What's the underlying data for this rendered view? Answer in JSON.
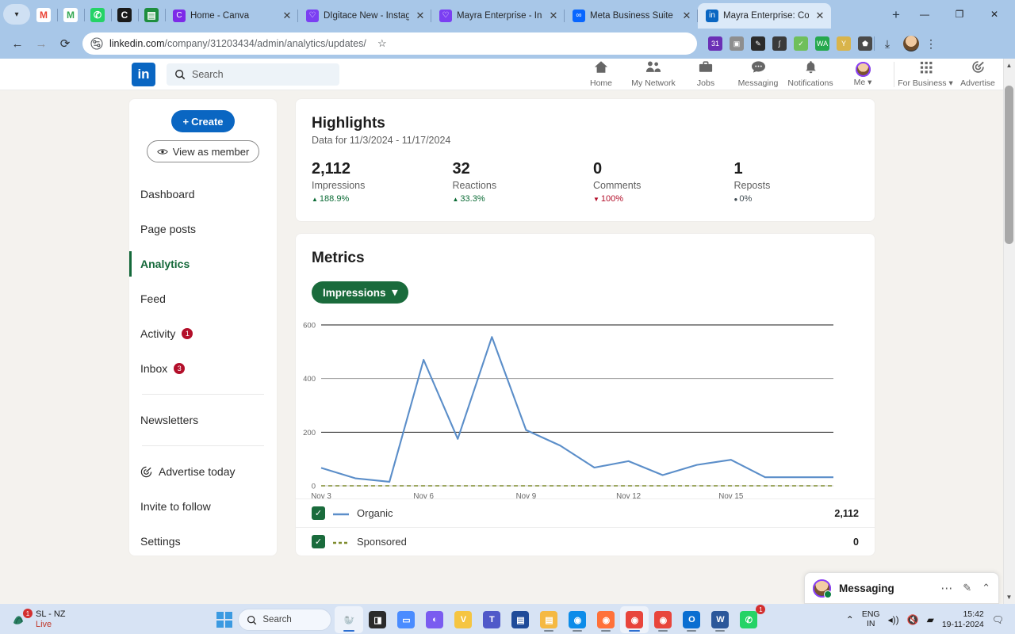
{
  "browser": {
    "pinned_tabs": [
      {
        "name": "gmail-pin",
        "glyph": "M",
        "color": "#ea4335",
        "bg": "#ffffff"
      },
      {
        "name": "gmail-alt-pin",
        "glyph": "M",
        "color": "#34a853",
        "bg": "#ffffff"
      },
      {
        "name": "whatsapp-pin",
        "glyph": "✆",
        "color": "#ffffff",
        "bg": "#25d366"
      },
      {
        "name": "canva-pin",
        "glyph": "C",
        "color": "#ffffff",
        "bg": "#1a1a1a"
      },
      {
        "name": "sheets-pin",
        "glyph": "▤",
        "color": "#ffffff",
        "bg": "#1e8e3e"
      }
    ],
    "tabs": [
      {
        "title": "Home - Canva",
        "favicon": "canva-icon",
        "fav_color": "#7d2ae8",
        "fav_glyph": "C",
        "active": false
      },
      {
        "title": "DIgitace New - Instagram",
        "favicon": "instagram-icon",
        "fav_color": "#7b3ff2",
        "fav_glyph": "♡",
        "active": false
      },
      {
        "title": "Mayra Enterprise - Instagr",
        "favicon": "instagram-icon",
        "fav_color": "#7b3ff2",
        "fav_glyph": "♡",
        "active": false
      },
      {
        "title": "Meta Business Suite",
        "favicon": "meta-icon",
        "fav_color": "#0866ff",
        "fav_glyph": "∞",
        "active": false
      },
      {
        "title": "Mayra Enterprise: Compan",
        "favicon": "linkedin-icon",
        "fav_color": "#0a66c2",
        "fav_glyph": "in",
        "active": true
      }
    ],
    "new_tab_label": "+",
    "window_controls": {
      "minimize": "—",
      "maximize": "❐",
      "close": "✕"
    },
    "nav": {
      "back": "←",
      "forward": "→",
      "reload": "⟳"
    },
    "url_domain": "linkedin.com",
    "url_path": "/company/31203434/admin/analytics/updates/",
    "star": "☆",
    "extensions": [
      {
        "name": "calendar-extension-icon",
        "glyph": "31",
        "bg": "#6b2fb5"
      },
      {
        "name": "camera-extension-icon",
        "glyph": "▣",
        "bg": "#8e8e8e"
      },
      {
        "name": "pen-extension-icon",
        "glyph": "✎",
        "bg": "#2b2b2b"
      },
      {
        "name": "formula-extension-icon",
        "glyph": "∫",
        "bg": "#3a3a3a"
      },
      {
        "name": "grammar-extension-icon",
        "glyph": "✓",
        "bg": "#6fbf5a"
      },
      {
        "name": "wa-extension-icon",
        "glyph": "WA",
        "bg": "#25a84d"
      },
      {
        "name": "y-extension-icon",
        "glyph": "Y",
        "bg": "#d9b44a"
      },
      {
        "name": "puzzle-extension-icon",
        "glyph": "⬟",
        "bg": "#4a4a4a"
      }
    ],
    "download_icon": "⤓",
    "menu_icon": "⋮"
  },
  "linkedin_nav": {
    "logo": "in",
    "search_placeholder": "Search",
    "items": [
      {
        "label": "Home",
        "icon": "home-icon"
      },
      {
        "label": "My Network",
        "icon": "network-icon"
      },
      {
        "label": "Jobs",
        "icon": "briefcase-icon"
      },
      {
        "label": "Messaging",
        "icon": "message-icon"
      },
      {
        "label": "Notifications",
        "icon": "bell-icon"
      },
      {
        "label": "Me",
        "icon": "avatar-icon"
      }
    ],
    "right_items": [
      {
        "label": "For Business",
        "icon": "grid-icon"
      },
      {
        "label": "Advertise",
        "icon": "advertise-icon"
      }
    ]
  },
  "sidebar": {
    "create_button": "Create",
    "create_plus": "+",
    "view_as_member": "View as member",
    "items": [
      {
        "label": "Dashboard",
        "active": false,
        "badge": null
      },
      {
        "label": "Page posts",
        "active": false,
        "badge": null
      },
      {
        "label": "Analytics",
        "active": true,
        "badge": null
      },
      {
        "label": "Feed",
        "active": false,
        "badge": null
      },
      {
        "label": "Activity",
        "active": false,
        "badge": "1"
      },
      {
        "label": "Inbox",
        "active": false,
        "badge": "3"
      }
    ],
    "newsletters": "Newsletters",
    "advertise_today": "Advertise today",
    "invite_to_follow": "Invite to follow",
    "settings": "Settings"
  },
  "highlights": {
    "title": "Highlights",
    "subtitle": "Data for 11/3/2024 - 11/17/2024",
    "stats": [
      {
        "value": "2,112",
        "label": "Impressions",
        "delta": "188.9%",
        "dir": "up",
        "arrow": "▲"
      },
      {
        "value": "32",
        "label": "Reactions",
        "delta": "33.3%",
        "dir": "up",
        "arrow": "▲"
      },
      {
        "value": "0",
        "label": "Comments",
        "delta": "100%",
        "dir": "down",
        "arrow": "▼"
      },
      {
        "value": "1",
        "label": "Reposts",
        "delta": "0%",
        "dir": "flat",
        "arrow": "●"
      }
    ]
  },
  "metrics": {
    "title": "Metrics",
    "selector_label": "Impressions",
    "selector_caret": "▾",
    "legend": [
      {
        "name": "Organic",
        "value": "2,112",
        "color": "#5b8ec9",
        "style": "solid",
        "checked": true
      },
      {
        "name": "Sponsored",
        "value": "0",
        "color": "#7f8c2e",
        "style": "dashed",
        "checked": true
      }
    ]
  },
  "chart_data": {
    "type": "line",
    "title": "Impressions",
    "xlabel": "",
    "ylabel": "",
    "ylim": [
      0,
      600
    ],
    "yticks": [
      0,
      200,
      400,
      600
    ],
    "grid": true,
    "legend_position": "below",
    "x": [
      "Nov 3",
      "Nov 4",
      "Nov 5",
      "Nov 6",
      "Nov 7",
      "Nov 8",
      "Nov 9",
      "Nov 10",
      "Nov 11",
      "Nov 12",
      "Nov 13",
      "Nov 14",
      "Nov 15",
      "Nov 16",
      "Nov 17",
      "Nov 18"
    ],
    "xtick_labels": [
      "Nov 3",
      "Nov 6",
      "Nov 9",
      "Nov 12",
      "Nov 15"
    ],
    "series": [
      {
        "name": "Organic",
        "color": "#5b8ec9",
        "style": "solid",
        "values": [
          67,
          28,
          15,
          470,
          175,
          555,
          208,
          150,
          68,
          92,
          40,
          78,
          97,
          32,
          32,
          32
        ]
      },
      {
        "name": "Sponsored",
        "color": "#7f8c2e",
        "style": "dashed",
        "values": [
          0,
          0,
          0,
          0,
          0,
          0,
          0,
          0,
          0,
          0,
          0,
          0,
          0,
          0,
          0,
          0
        ]
      }
    ]
  },
  "messaging": {
    "title": "Messaging",
    "more_icon": "⋯",
    "compose_icon": "✎",
    "expand_icon": "⌃"
  },
  "taskbar": {
    "widget": {
      "line1": "SL - NZ",
      "line2": "Live",
      "badge": "1"
    },
    "start_label": "start-button",
    "search_placeholder": "Search",
    "apps": [
      {
        "name": "manatee-app",
        "glyph": "🦭",
        "bg": "transparent",
        "active": true,
        "running": false
      },
      {
        "name": "dark-square-app",
        "glyph": "◨",
        "bg": "#2b2b2b",
        "active": false,
        "running": false
      },
      {
        "name": "zoom-app",
        "glyph": "▭",
        "bg": "#4a8cff",
        "active": false,
        "running": false
      },
      {
        "name": "copilot-app",
        "glyph": "◐",
        "bg": "#7a5cf0",
        "active": false,
        "running": false
      },
      {
        "name": "vivaldi-app",
        "glyph": "V",
        "bg": "#f5c542",
        "active": false,
        "running": false
      },
      {
        "name": "teams-app",
        "glyph": "T",
        "bg": "#5059c9",
        "active": false,
        "running": false
      },
      {
        "name": "store-app",
        "glyph": "▤",
        "bg": "#1f4b99",
        "active": false,
        "running": false
      },
      {
        "name": "file-explorer-app",
        "glyph": "▤",
        "bg": "#f5b942",
        "active": false,
        "running": true
      },
      {
        "name": "edge-app",
        "glyph": "◉",
        "bg": "#0c8ce9",
        "active": false,
        "running": true
      },
      {
        "name": "firefox-app",
        "glyph": "◉",
        "bg": "#ff7139",
        "active": false,
        "running": true
      },
      {
        "name": "chrome-app",
        "glyph": "◉",
        "bg": "#e8453c",
        "active": true,
        "running": true
      },
      {
        "name": "chrome-profile-app",
        "glyph": "◉",
        "bg": "#e8453c",
        "active": false,
        "running": true
      },
      {
        "name": "outlook-app",
        "glyph": "O",
        "bg": "#0a6ed1",
        "active": false,
        "running": true
      },
      {
        "name": "word-app",
        "glyph": "W",
        "bg": "#2b579a",
        "active": false,
        "running": true
      },
      {
        "name": "whatsapp-app",
        "glyph": "✆",
        "bg": "#25d366",
        "active": false,
        "running": false,
        "badge": "1"
      }
    ],
    "tray": {
      "chevron": "⌃",
      "lang_line1": "ENG",
      "lang_line2": "IN",
      "wifi": "◂))",
      "volume": "🔇",
      "battery": "▰",
      "time": "15:42",
      "date": "19-11-2024",
      "notification": "🗨"
    }
  }
}
